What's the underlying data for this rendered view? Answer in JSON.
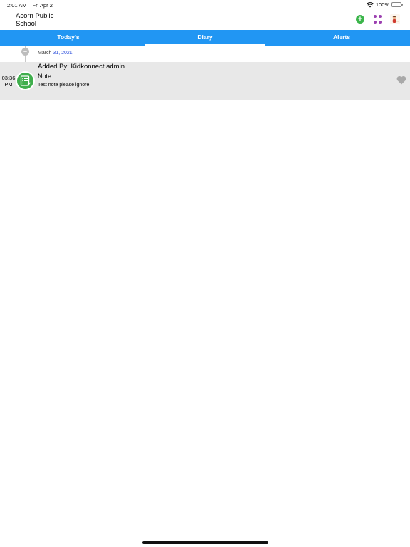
{
  "status_bar": {
    "time": "2:01 AM",
    "date": "Fri Apr 2",
    "battery": "100%"
  },
  "header": {
    "school_name": "Acorn Public School",
    "icons": [
      "add-circle-icon",
      "grid-dots-icon",
      "avatar"
    ],
    "accent_color": "#2196f3"
  },
  "tabs": [
    {
      "label": "Today's",
      "active": false
    },
    {
      "label": "Diary",
      "active": true
    },
    {
      "label": "Alerts",
      "active": false
    }
  ],
  "diary": {
    "date_month": "March",
    "date_rest": "31, 2021",
    "entries": [
      {
        "time_line1": "03:36",
        "time_line2": "PM",
        "added_by": "Added By: Kidkonnect admin",
        "title": "Note",
        "body": "Test note please ignore.",
        "icon": "note-icon"
      }
    ]
  }
}
